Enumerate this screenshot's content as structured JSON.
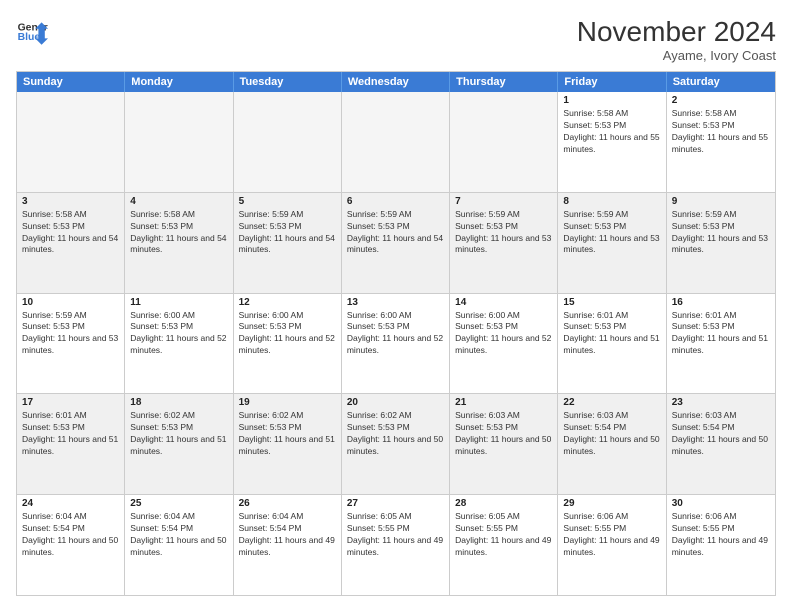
{
  "header": {
    "logo": {
      "general": "General",
      "blue": "Blue"
    },
    "month": "November 2024",
    "location": "Ayame, Ivory Coast"
  },
  "weekdays": [
    "Sunday",
    "Monday",
    "Tuesday",
    "Wednesday",
    "Thursday",
    "Friday",
    "Saturday"
  ],
  "weeks": [
    [
      {
        "day": null,
        "empty": true
      },
      {
        "day": null,
        "empty": true
      },
      {
        "day": null,
        "empty": true
      },
      {
        "day": null,
        "empty": true
      },
      {
        "day": null,
        "empty": true
      },
      {
        "day": "1",
        "sunrise": "Sunrise: 5:58 AM",
        "sunset": "Sunset: 5:53 PM",
        "daylight": "Daylight: 11 hours and 55 minutes."
      },
      {
        "day": "2",
        "sunrise": "Sunrise: 5:58 AM",
        "sunset": "Sunset: 5:53 PM",
        "daylight": "Daylight: 11 hours and 55 minutes."
      }
    ],
    [
      {
        "day": "3",
        "sunrise": "Sunrise: 5:58 AM",
        "sunset": "Sunset: 5:53 PM",
        "daylight": "Daylight: 11 hours and 54 minutes."
      },
      {
        "day": "4",
        "sunrise": "Sunrise: 5:58 AM",
        "sunset": "Sunset: 5:53 PM",
        "daylight": "Daylight: 11 hours and 54 minutes."
      },
      {
        "day": "5",
        "sunrise": "Sunrise: 5:59 AM",
        "sunset": "Sunset: 5:53 PM",
        "daylight": "Daylight: 11 hours and 54 minutes."
      },
      {
        "day": "6",
        "sunrise": "Sunrise: 5:59 AM",
        "sunset": "Sunset: 5:53 PM",
        "daylight": "Daylight: 11 hours and 54 minutes."
      },
      {
        "day": "7",
        "sunrise": "Sunrise: 5:59 AM",
        "sunset": "Sunset: 5:53 PM",
        "daylight": "Daylight: 11 hours and 53 minutes."
      },
      {
        "day": "8",
        "sunrise": "Sunrise: 5:59 AM",
        "sunset": "Sunset: 5:53 PM",
        "daylight": "Daylight: 11 hours and 53 minutes."
      },
      {
        "day": "9",
        "sunrise": "Sunrise: 5:59 AM",
        "sunset": "Sunset: 5:53 PM",
        "daylight": "Daylight: 11 hours and 53 minutes."
      }
    ],
    [
      {
        "day": "10",
        "sunrise": "Sunrise: 5:59 AM",
        "sunset": "Sunset: 5:53 PM",
        "daylight": "Daylight: 11 hours and 53 minutes."
      },
      {
        "day": "11",
        "sunrise": "Sunrise: 6:00 AM",
        "sunset": "Sunset: 5:53 PM",
        "daylight": "Daylight: 11 hours and 52 minutes."
      },
      {
        "day": "12",
        "sunrise": "Sunrise: 6:00 AM",
        "sunset": "Sunset: 5:53 PM",
        "daylight": "Daylight: 11 hours and 52 minutes."
      },
      {
        "day": "13",
        "sunrise": "Sunrise: 6:00 AM",
        "sunset": "Sunset: 5:53 PM",
        "daylight": "Daylight: 11 hours and 52 minutes."
      },
      {
        "day": "14",
        "sunrise": "Sunrise: 6:00 AM",
        "sunset": "Sunset: 5:53 PM",
        "daylight": "Daylight: 11 hours and 52 minutes."
      },
      {
        "day": "15",
        "sunrise": "Sunrise: 6:01 AM",
        "sunset": "Sunset: 5:53 PM",
        "daylight": "Daylight: 11 hours and 51 minutes."
      },
      {
        "day": "16",
        "sunrise": "Sunrise: 6:01 AM",
        "sunset": "Sunset: 5:53 PM",
        "daylight": "Daylight: 11 hours and 51 minutes."
      }
    ],
    [
      {
        "day": "17",
        "sunrise": "Sunrise: 6:01 AM",
        "sunset": "Sunset: 5:53 PM",
        "daylight": "Daylight: 11 hours and 51 minutes."
      },
      {
        "day": "18",
        "sunrise": "Sunrise: 6:02 AM",
        "sunset": "Sunset: 5:53 PM",
        "daylight": "Daylight: 11 hours and 51 minutes."
      },
      {
        "day": "19",
        "sunrise": "Sunrise: 6:02 AM",
        "sunset": "Sunset: 5:53 PM",
        "daylight": "Daylight: 11 hours and 51 minutes."
      },
      {
        "day": "20",
        "sunrise": "Sunrise: 6:02 AM",
        "sunset": "Sunset: 5:53 PM",
        "daylight": "Daylight: 11 hours and 50 minutes."
      },
      {
        "day": "21",
        "sunrise": "Sunrise: 6:03 AM",
        "sunset": "Sunset: 5:53 PM",
        "daylight": "Daylight: 11 hours and 50 minutes."
      },
      {
        "day": "22",
        "sunrise": "Sunrise: 6:03 AM",
        "sunset": "Sunset: 5:54 PM",
        "daylight": "Daylight: 11 hours and 50 minutes."
      },
      {
        "day": "23",
        "sunrise": "Sunrise: 6:03 AM",
        "sunset": "Sunset: 5:54 PM",
        "daylight": "Daylight: 11 hours and 50 minutes."
      }
    ],
    [
      {
        "day": "24",
        "sunrise": "Sunrise: 6:04 AM",
        "sunset": "Sunset: 5:54 PM",
        "daylight": "Daylight: 11 hours and 50 minutes."
      },
      {
        "day": "25",
        "sunrise": "Sunrise: 6:04 AM",
        "sunset": "Sunset: 5:54 PM",
        "daylight": "Daylight: 11 hours and 50 minutes."
      },
      {
        "day": "26",
        "sunrise": "Sunrise: 6:04 AM",
        "sunset": "Sunset: 5:54 PM",
        "daylight": "Daylight: 11 hours and 49 minutes."
      },
      {
        "day": "27",
        "sunrise": "Sunrise: 6:05 AM",
        "sunset": "Sunset: 5:55 PM",
        "daylight": "Daylight: 11 hours and 49 minutes."
      },
      {
        "day": "28",
        "sunrise": "Sunrise: 6:05 AM",
        "sunset": "Sunset: 5:55 PM",
        "daylight": "Daylight: 11 hours and 49 minutes."
      },
      {
        "day": "29",
        "sunrise": "Sunrise: 6:06 AM",
        "sunset": "Sunset: 5:55 PM",
        "daylight": "Daylight: 11 hours and 49 minutes."
      },
      {
        "day": "30",
        "sunrise": "Sunrise: 6:06 AM",
        "sunset": "Sunset: 5:55 PM",
        "daylight": "Daylight: 11 hours and 49 minutes."
      }
    ]
  ]
}
